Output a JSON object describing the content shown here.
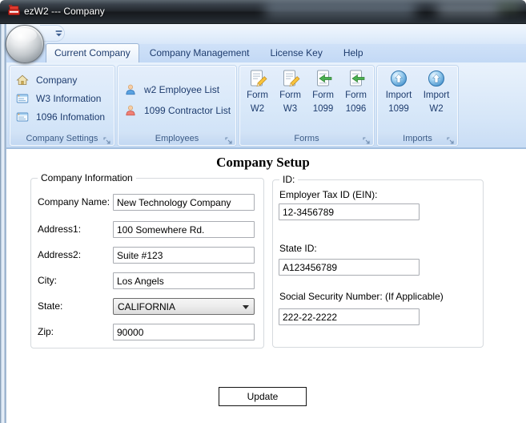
{
  "window": {
    "title": "ezW2 --- Company"
  },
  "ribbon": {
    "tabs": [
      {
        "label": "Current Company"
      },
      {
        "label": "Company Management"
      },
      {
        "label": "License Key"
      },
      {
        "label": "Help"
      }
    ],
    "groups": [
      {
        "label": "Company Settings",
        "items": [
          {
            "label": "Company",
            "icon": "home-icon"
          },
          {
            "label": "W3 Information",
            "icon": "form-window-icon"
          },
          {
            "label": "1096 Infomation",
            "icon": "form-window-icon"
          }
        ]
      },
      {
        "label": "Employees",
        "items": [
          {
            "label": "w2 Employee List",
            "icon": "person-blue-icon"
          },
          {
            "label": "1099 Contractor List",
            "icon": "person-red-icon"
          }
        ]
      },
      {
        "label": "Forms",
        "items": [
          {
            "lines": [
              "Form",
              "W2"
            ],
            "icon": "form-edit-icon"
          },
          {
            "lines": [
              "Form",
              "W3"
            ],
            "icon": "form-edit-icon"
          },
          {
            "lines": [
              "Form",
              "1099"
            ],
            "icon": "form-import-icon"
          },
          {
            "lines": [
              "Form",
              "1096"
            ],
            "icon": "form-import-icon"
          }
        ]
      },
      {
        "label": "Imports",
        "items": [
          {
            "lines": [
              "Import",
              "1099"
            ],
            "icon": "import-sphere-icon"
          },
          {
            "lines": [
              "Import",
              "W2"
            ],
            "icon": "import-sphere-icon"
          }
        ]
      }
    ]
  },
  "content": {
    "heading": "Company Setup",
    "company_info": {
      "legend": "Company Information",
      "fields": [
        {
          "label": "Company Name:",
          "value": "New Technology Company"
        },
        {
          "label": "Address1:",
          "value": "100 Somewhere Rd."
        },
        {
          "label": "Address2:",
          "value": "Suite #123"
        },
        {
          "label": "City:",
          "value": "Los Angels"
        },
        {
          "label": "State:",
          "value": "CALIFORNIA"
        },
        {
          "label": "Zip:",
          "value": "90000"
        }
      ]
    },
    "id_info": {
      "legend": "ID:",
      "fields": [
        {
          "label": "Employer Tax ID (EIN):",
          "value": "12-3456789"
        },
        {
          "label": "State ID:",
          "value": "A123456789"
        },
        {
          "label": "Social Security Number: (If Applicable)",
          "value": "222-22-2222"
        }
      ]
    },
    "update_button_label": "Update"
  },
  "colors": {
    "ribbon_text": "#1e3c6e",
    "group_label_text": "#3c5c87",
    "titlebar_text": "#ffffff",
    "app_icon_red": "#cf2920"
  }
}
